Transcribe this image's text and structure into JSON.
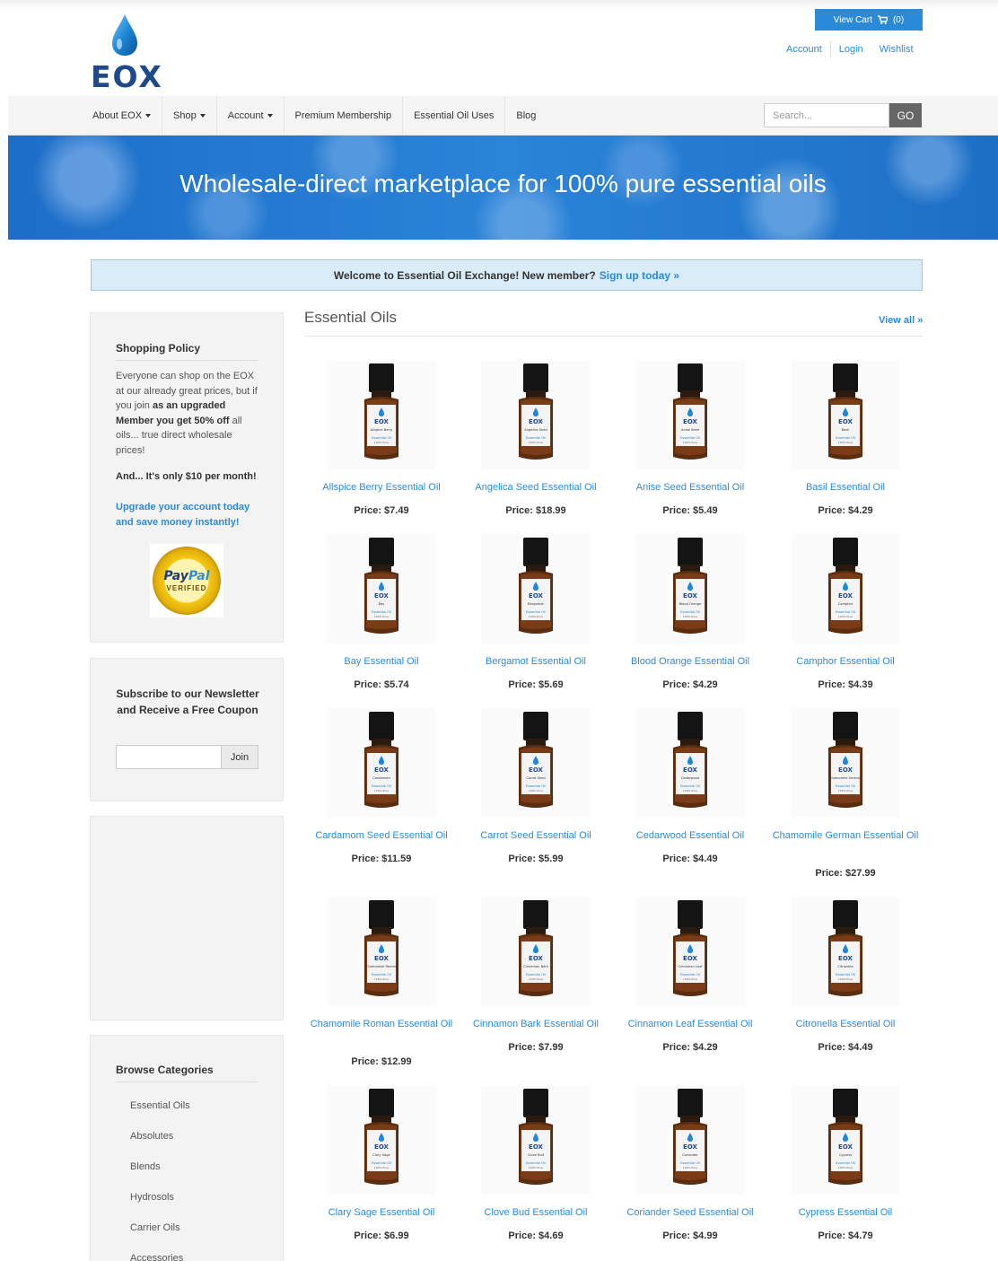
{
  "brand": {
    "logo_text": "EOX"
  },
  "header": {
    "view_cart_label": "View Cart",
    "cart_count": "(0)",
    "links": [
      "Account",
      "Login",
      "Wishlist"
    ]
  },
  "nav": {
    "items": [
      {
        "label": "About EOX",
        "dropdown": true
      },
      {
        "label": "Shop",
        "dropdown": true
      },
      {
        "label": "Account",
        "dropdown": true
      },
      {
        "label": "Premium Membership",
        "dropdown": false
      },
      {
        "label": "Essential Oil Uses",
        "dropdown": false
      },
      {
        "label": "Blog",
        "dropdown": false
      }
    ],
    "search_placeholder": "Search...",
    "go_label": "GO"
  },
  "banner": {
    "text": "Wholesale-direct marketplace for 100% pure essential oils"
  },
  "welcome": {
    "text": "Welcome to Essential Oil Exchange! New member?",
    "link": "Sign up today »"
  },
  "sidebar": {
    "shopping_policy": {
      "title": "Shopping Policy",
      "text_a": "Everyone can shop on the EOX at our already great prices, but if you join ",
      "text_b": "as an upgraded Member you get 50% off",
      "text_c": " all oils... true direct wholesale prices!",
      "note": "And... It's only $10 per month!",
      "upgrade_link": "Upgrade your account today and save money instantly!",
      "badge_pay": "Pay",
      "badge_pal": "Pal",
      "badge_verified": "VERIFIED"
    },
    "newsletter": {
      "title": "Subscribe to our Newsletter and Receive a Free Coupon",
      "join_label": "Join"
    },
    "categories": {
      "title": "Browse Categories",
      "items": [
        "Essential Oils",
        "Absolutes",
        "Blends",
        "Hydrosols",
        "Carrier Oils",
        "Accessories"
      ]
    }
  },
  "main": {
    "title": "Essential Oils",
    "view_all": "View all »",
    "products": [
      {
        "name": "Allspice Berry Essential Oil",
        "price": "Price: $7.49",
        "label": "Allspice Berry"
      },
      {
        "name": "Angelica Seed Essential Oil",
        "price": "Price: $18.99",
        "label": "Angelica Seed"
      },
      {
        "name": "Anise Seed Essential Oil",
        "price": "Price: $5.49",
        "label": "Anise Seed"
      },
      {
        "name": "Basil Essential Oil",
        "price": "Price: $4.29",
        "label": "Basil"
      },
      {
        "name": "Bay Essential Oil",
        "price": "Price: $5.74",
        "label": "Bay"
      },
      {
        "name": "Bergamot Essential Oil",
        "price": "Price: $5.69",
        "label": "Bergamot"
      },
      {
        "name": "Blood Orange Essential Oil",
        "price": "Price: $4.29",
        "label": "Blood Orange"
      },
      {
        "name": "Camphor Essential Oil",
        "price": "Price: $4.39",
        "label": "Camphor"
      },
      {
        "name": "Cardamom Seed Essential Oil",
        "price": "Price: $11.59",
        "label": "Cardamom"
      },
      {
        "name": "Carrot Seed Essential Oil",
        "price": "Price: $5.99",
        "label": "Carrot Seed"
      },
      {
        "name": "Cedarwood Essential Oil",
        "price": "Price: $4.49",
        "label": "Cedarwood"
      },
      {
        "name": "Chamomile German Essential Oil",
        "price": "Price: $27.99",
        "label": "Chamomile German"
      },
      {
        "name": "Chamomile Roman Essential Oil",
        "price": "Price: $12.99",
        "label": "Chamomile Roman"
      },
      {
        "name": "Cinnamon Bark Essential Oil",
        "price": "Price: $7.99",
        "label": "Cinnamon Bark"
      },
      {
        "name": "Cinnamon Leaf Essential Oil",
        "price": "Price: $4.29",
        "label": "Cinnamon Leaf"
      },
      {
        "name": "Citronella Essential Oil",
        "price": "Price: $4.49",
        "label": "Citronella"
      },
      {
        "name": "Clary Sage Essential Oil",
        "price": "Price: $6.99",
        "label": "Clary Sage"
      },
      {
        "name": "Clove Bud Essential Oil",
        "price": "Price: $4.69",
        "label": "Clove Bud"
      },
      {
        "name": "Coriander Seed Essential Oil",
        "price": "Price: $4.99",
        "label": "Coriander"
      },
      {
        "name": "Cypress Essential Oil",
        "price": "Price: $4.79",
        "label": "Cypress"
      }
    ],
    "bottle_text": {
      "brand": "EOX",
      "kind": "Essential Oil",
      "purity": "100% Pure"
    }
  },
  "colors": {
    "accent": "#2b8ad8",
    "logo": "#1e4a8c",
    "drop": "#1e88d6",
    "banner": "#2a84d8"
  }
}
